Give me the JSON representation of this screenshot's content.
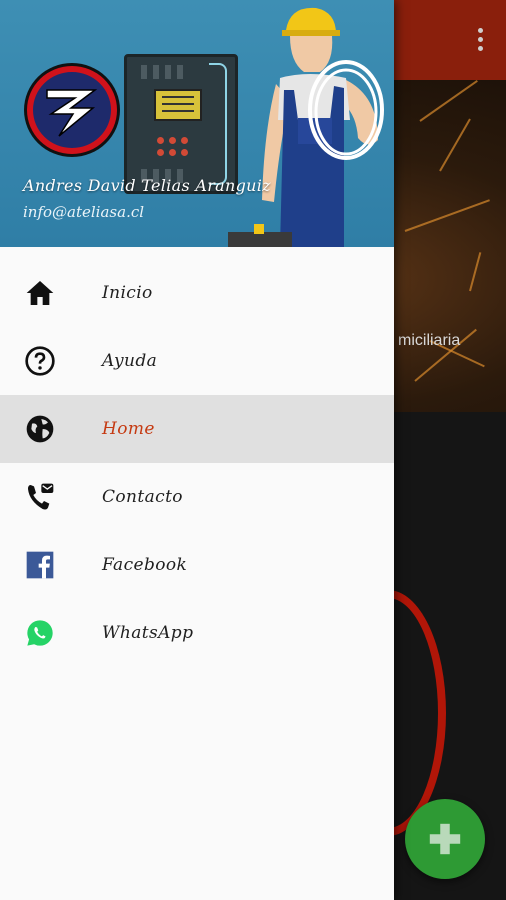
{
  "drawer": {
    "user_name": "Andres David Telias Aranguiz",
    "user_email": "info@ateliasa.cl",
    "items": [
      {
        "label": "Inicio",
        "icon": "home-icon",
        "active": false
      },
      {
        "label": "Ayuda",
        "icon": "help-circle-icon",
        "active": false
      },
      {
        "label": "Home",
        "icon": "globe-icon",
        "active": true
      },
      {
        "label": "Contacto",
        "icon": "phone-message-icon",
        "active": false
      },
      {
        "label": "Facebook",
        "icon": "facebook-icon",
        "active": false
      },
      {
        "label": "WhatsApp",
        "icon": "whatsapp-icon",
        "active": false
      }
    ]
  },
  "background": {
    "hero_text": "miciliaria"
  },
  "colors": {
    "header_bg": "#3a8ab0",
    "active_text": "#c53a12",
    "active_bg": "#e0e0e0",
    "toolbar": "#8a1f0c",
    "fab": "#2e9a34",
    "facebook": "#3b5998",
    "whatsapp": "#25d366"
  }
}
